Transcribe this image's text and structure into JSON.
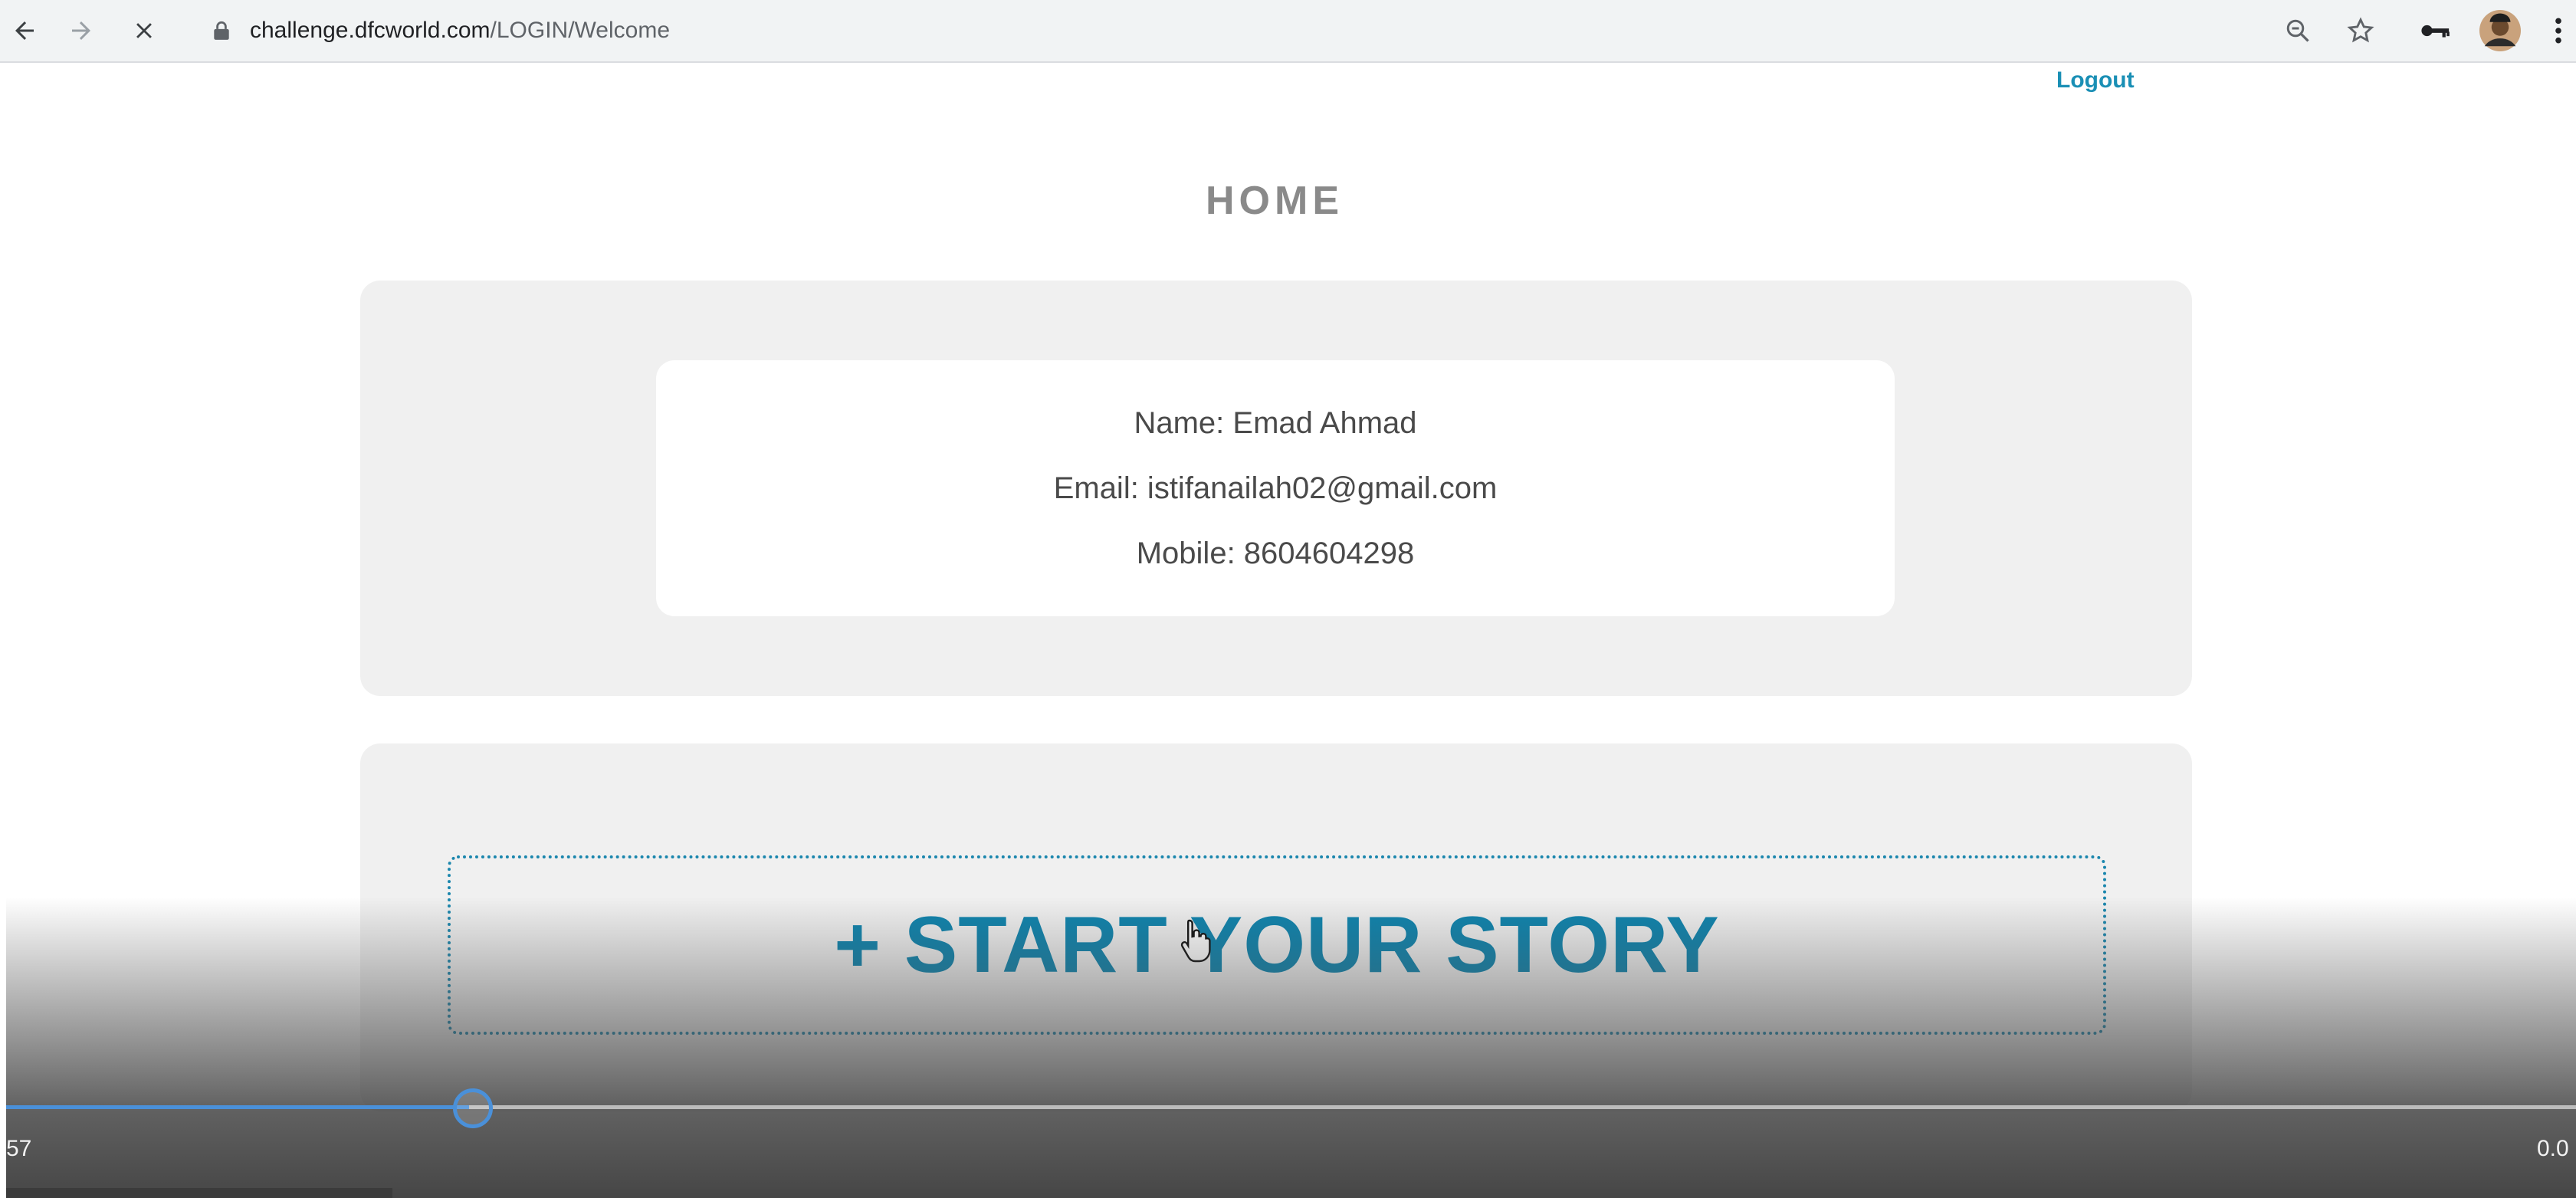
{
  "browser": {
    "url_domain": "challenge.dfcworld.com",
    "url_path": "/LOGIN/Welcome",
    "back_icon": "back-arrow-icon",
    "forward_icon": "forward-arrow-icon",
    "stop_icon": "close-icon",
    "lock_icon": "lock-icon",
    "zoom_icon": "zoom-icon",
    "star_icon": "star-icon",
    "key_icon": "key-icon",
    "avatar_icon": "profile-avatar-icon",
    "menu_icon": "more-vert-icon"
  },
  "page": {
    "logout_label": "Logout",
    "title": "HOME",
    "profile": {
      "name_line": "Name: Emad Ahmad",
      "email_line": "Email: istifanailah02@gmail.com",
      "mobile_line": "Mobile: 8604604298"
    },
    "story_button_label": "+ START YOUR STORY"
  },
  "video_player": {
    "time_elapsed": "57",
    "time_remaining": "0.0",
    "progress": 0.18
  },
  "colors": {
    "accent": "#1a86ad",
    "panel": "#f0f0f0",
    "title_gray": "#8a8a8a"
  }
}
